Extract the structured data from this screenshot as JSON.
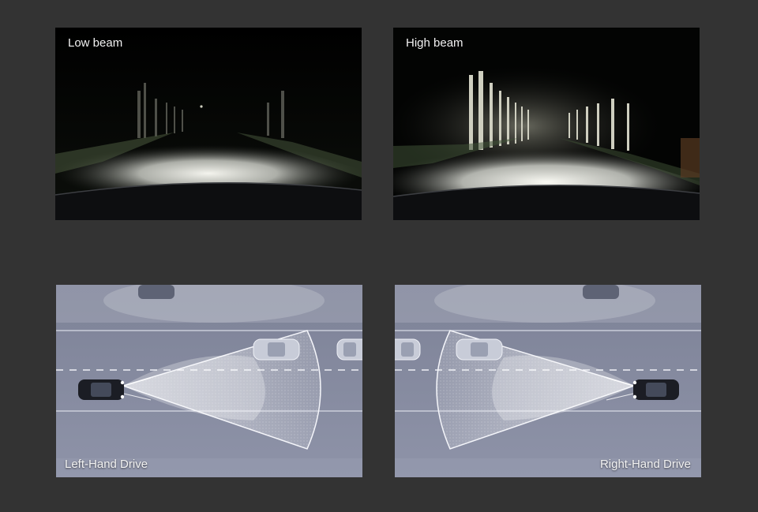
{
  "panels": {
    "low_beam": {
      "caption": "Low beam"
    },
    "high_beam": {
      "caption": "High beam"
    },
    "left_hand_drive": {
      "caption": "Left-Hand Drive"
    },
    "right_hand_drive": {
      "caption": "Right-Hand Drive"
    }
  },
  "colors": {
    "page_background": "#333333",
    "night_sky": "#050505",
    "road_diagram": "#8a8fa3",
    "beam_white": "#ffffff"
  }
}
